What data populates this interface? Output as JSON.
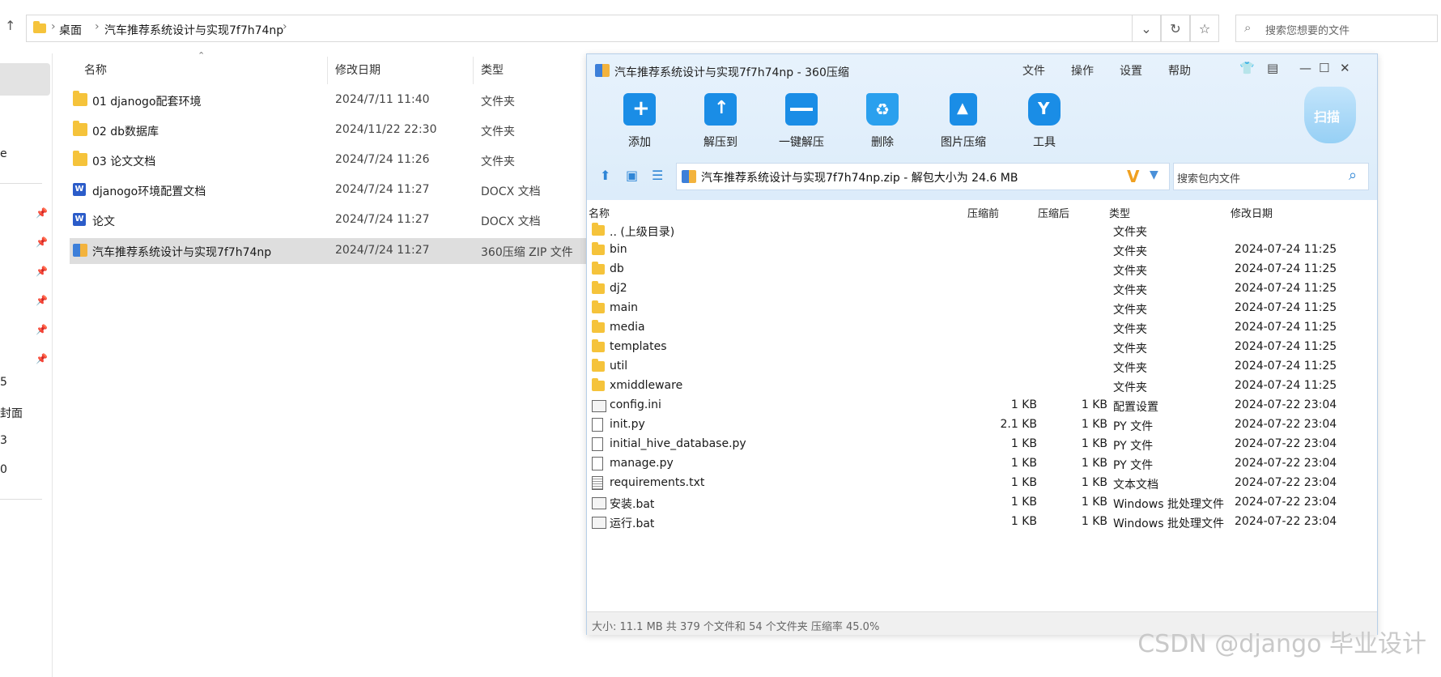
{
  "explorer": {
    "breadcrumb": [
      "桌面",
      "汽车推荐系统设计与实现7f7h74np"
    ],
    "search_placeholder": "搜索您想要的文件",
    "columns": {
      "name": "名称",
      "date": "修改日期",
      "type": "类型"
    },
    "files": [
      {
        "name": "01 djanogo配套环境",
        "date": "2024/7/11 11:40",
        "type": "文件夹",
        "icon": "folder-icon"
      },
      {
        "name": "02 db数据库",
        "date": "2024/11/22 22:30",
        "type": "文件夹",
        "icon": "folder-icon"
      },
      {
        "name": "03 论文文档",
        "date": "2024/7/24 11:26",
        "type": "文件夹",
        "icon": "folder-icon"
      },
      {
        "name": "djanogo环境配置文档",
        "date": "2024/7/24 11:27",
        "type": "DOCX 文档",
        "icon": "word-icon"
      },
      {
        "name": "论文",
        "date": "2024/7/24 11:27",
        "type": "DOCX 文档",
        "icon": "word-icon"
      },
      {
        "name": "汽车推荐系统设计与实现7f7h74np",
        "date": "2024/7/24 11:27",
        "type": "360压缩 ZIP 文件",
        "icon": "zip-icon",
        "selected": true
      }
    ],
    "left_nav_fragments": [
      "e",
      "5",
      "封面",
      "3",
      "0"
    ]
  },
  "zip": {
    "title": "汽车推荐系统设计与实现7f7h74np - 360压缩",
    "menu": [
      "文件",
      "操作",
      "设置",
      "帮助"
    ],
    "tools": [
      "添加",
      "解压到",
      "一键解压",
      "删除",
      "图片压缩",
      "工具"
    ],
    "scan_label": "扫描",
    "path": "汽车推荐系统设计与实现7f7h74np.zip - 解包大小为 24.6 MB",
    "search_placeholder": "搜索包内文件",
    "columns": {
      "name": "名称",
      "before": "压缩前",
      "after": "压缩后",
      "type": "类型",
      "date": "修改日期"
    },
    "entries": [
      {
        "name": ".. (上级目录)",
        "before": "",
        "after": "",
        "type": "文件夹",
        "date": "",
        "icon": "folder-icon"
      },
      {
        "name": "bin",
        "before": "",
        "after": "",
        "type": "文件夹",
        "date": "2024-07-24 11:25",
        "icon": "folder-icon"
      },
      {
        "name": "db",
        "before": "",
        "after": "",
        "type": "文件夹",
        "date": "2024-07-24 11:25",
        "icon": "folder-icon"
      },
      {
        "name": "dj2",
        "before": "",
        "after": "",
        "type": "文件夹",
        "date": "2024-07-24 11:25",
        "icon": "folder-icon"
      },
      {
        "name": "main",
        "before": "",
        "after": "",
        "type": "文件夹",
        "date": "2024-07-24 11:25",
        "icon": "folder-icon"
      },
      {
        "name": "media",
        "before": "",
        "after": "",
        "type": "文件夹",
        "date": "2024-07-24 11:25",
        "icon": "folder-icon"
      },
      {
        "name": "templates",
        "before": "",
        "after": "",
        "type": "文件夹",
        "date": "2024-07-24 11:25",
        "icon": "folder-icon"
      },
      {
        "name": "util",
        "before": "",
        "after": "",
        "type": "文件夹",
        "date": "2024-07-24 11:25",
        "icon": "folder-icon"
      },
      {
        "name": "xmiddleware",
        "before": "",
        "after": "",
        "type": "文件夹",
        "date": "2024-07-24 11:25",
        "icon": "folder-icon"
      },
      {
        "name": "config.ini",
        "before": "1 KB",
        "after": "1 KB",
        "type": "配置设置",
        "date": "2024-07-22 23:04",
        "icon": "settings-file-icon"
      },
      {
        "name": "init.py",
        "before": "2.1 KB",
        "after": "1 KB",
        "type": "PY 文件",
        "date": "2024-07-22 23:04",
        "icon": "file-icon"
      },
      {
        "name": "initial_hive_database.py",
        "before": "1 KB",
        "after": "1 KB",
        "type": "PY 文件",
        "date": "2024-07-22 23:04",
        "icon": "file-icon"
      },
      {
        "name": "manage.py",
        "before": "1 KB",
        "after": "1 KB",
        "type": "PY 文件",
        "date": "2024-07-22 23:04",
        "icon": "file-icon"
      },
      {
        "name": "requirements.txt",
        "before": "1 KB",
        "after": "1 KB",
        "type": "文本文档",
        "date": "2024-07-22 23:04",
        "icon": "text-file-icon"
      },
      {
        "name": "安装.bat",
        "before": "1 KB",
        "after": "1 KB",
        "type": "Windows 批处理文件",
        "date": "2024-07-22 23:04",
        "icon": "batch-file-icon"
      },
      {
        "name": "运行.bat",
        "before": "1 KB",
        "after": "1 KB",
        "type": "Windows 批处理文件",
        "date": "2024-07-22 23:04",
        "icon": "batch-file-icon"
      }
    ],
    "status": "大小: 11.1 MB 共 379 个文件和 54 个文件夹 压缩率 45.0%"
  },
  "watermark": "CSDN @django 毕业设计"
}
